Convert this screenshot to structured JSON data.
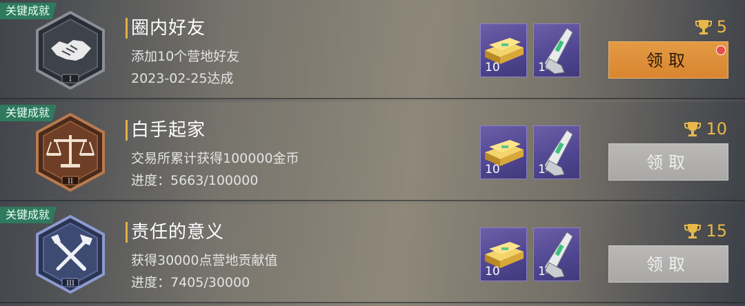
{
  "achievements": [
    {
      "tag": "关键成就",
      "title": "圈内好友",
      "description": "添加10个营地好友",
      "status": "2023-02-25达成",
      "badge_icon": "handshake-icon",
      "badge_tier": "I",
      "rewards": [
        {
          "icon": "gold-bars-icon",
          "count": "10"
        },
        {
          "icon": "weapon-part-icon",
          "count": "1"
        }
      ],
      "trophy_points": "5",
      "button_label": "领取",
      "button_state": "active",
      "has_notification": true
    },
    {
      "tag": "关键成就",
      "title": "白手起家",
      "description": "交易所累计获得100000金币",
      "status": "进度：5663/100000",
      "badge_icon": "scales-icon",
      "badge_tier": "II",
      "rewards": [
        {
          "icon": "gold-bars-icon",
          "count": "10"
        },
        {
          "icon": "weapon-part-icon",
          "count": "1"
        }
      ],
      "trophy_points": "10",
      "button_label": "领取",
      "button_state": "disabled",
      "has_notification": false
    },
    {
      "tag": "关键成就",
      "title": "责任的意义",
      "description": "获得30000点营地贡献值",
      "status": "进度：7405/30000",
      "badge_icon": "hammer-screwdriver-icon",
      "badge_tier": "III",
      "rewards": [
        {
          "icon": "gold-bars-icon",
          "count": "10"
        },
        {
          "icon": "weapon-part-icon",
          "count": "1"
        }
      ],
      "trophy_points": "15",
      "button_label": "领取",
      "button_state": "disabled",
      "has_notification": false
    }
  ],
  "colors": {
    "tag_bg": "#2f7a5f",
    "trophy": "#e8b84a",
    "button_active": "#e0903a",
    "button_disabled": "#b0afad",
    "reward_bg": "#5a4f9a",
    "badge_tier1": "#4a4f58",
    "badge_tier2": "#7a4a30",
    "badge_tier3": "#4a5a88"
  }
}
